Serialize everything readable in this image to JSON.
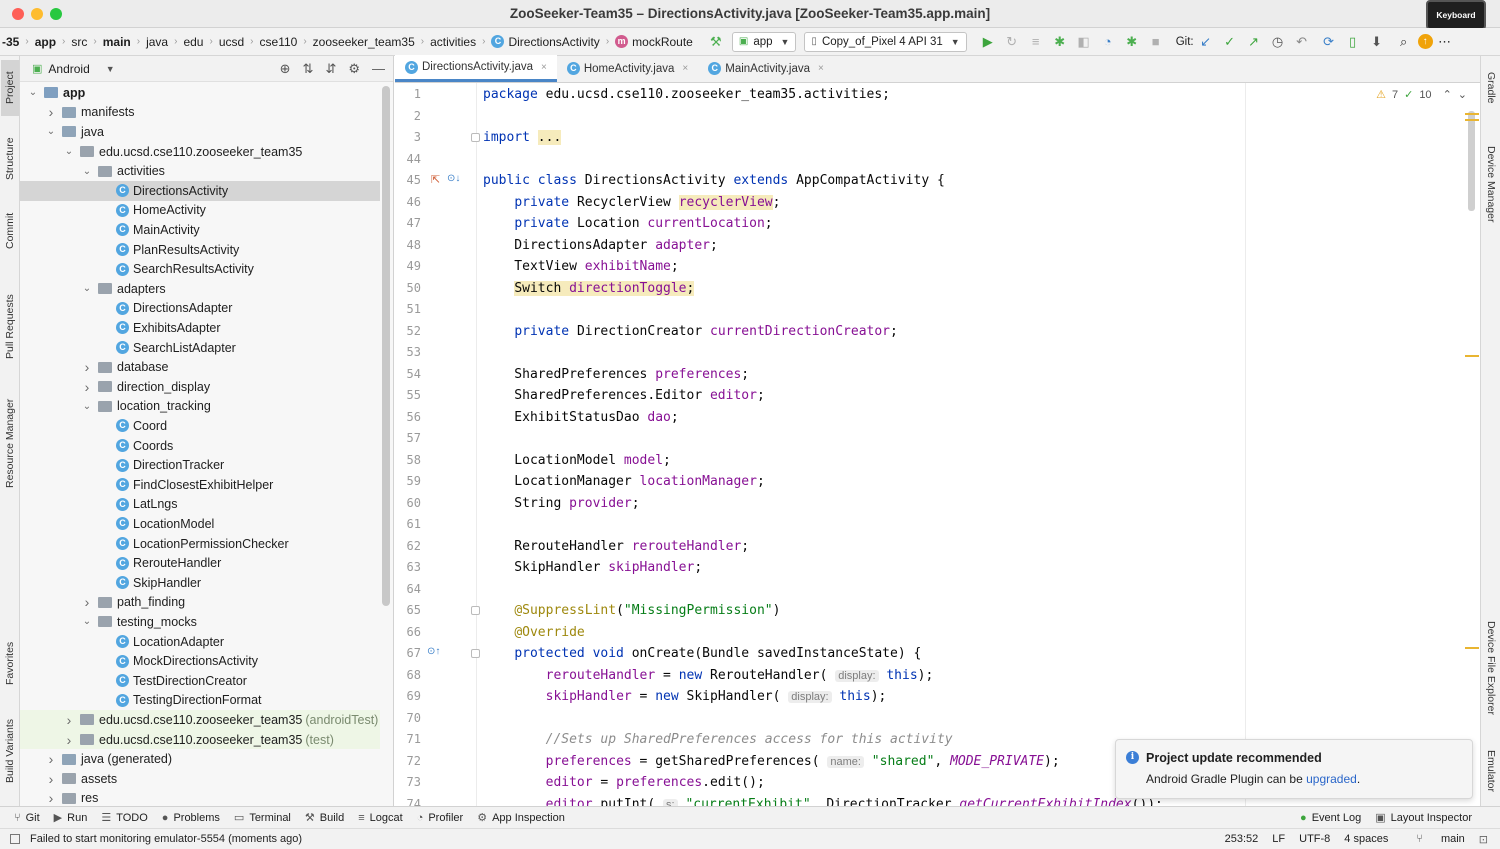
{
  "window": {
    "title": "ZooSeeker-Team35 – DirectionsActivity.java [ZooSeeker-Team35.app.main]",
    "keyboard_badge": "Keyboard"
  },
  "navbar": {
    "breadcrumbs": [
      "-35",
      "app",
      "src",
      "main",
      "java",
      "edu",
      "ucsd",
      "cse110",
      "zooseeker_team35",
      "activities",
      "DirectionsActivity",
      "mockRoute"
    ],
    "run_config": "app",
    "device": "Copy_of_Pixel 4 API 31",
    "git_label": "Git:"
  },
  "left_strip": {
    "tabs": [
      "Project",
      "Structure",
      "Commit",
      "Pull Requests",
      "Resource Manager",
      "Favorites",
      "Build Variants"
    ]
  },
  "right_strip": {
    "tabs": [
      "Gradle",
      "Device Manager",
      "Device File Explorer",
      "Emulator"
    ]
  },
  "project_panel": {
    "view_mode": "Android",
    "tree": [
      {
        "label": "app",
        "level": 0,
        "expanded": true,
        "kind": "module",
        "bold": true
      },
      {
        "label": "manifests",
        "level": 1,
        "expanded": false,
        "kind": "folder"
      },
      {
        "label": "java",
        "level": 1,
        "expanded": true,
        "kind": "folder"
      },
      {
        "label": "edu.ucsd.cse110.zooseeker_team35",
        "level": 2,
        "expanded": true,
        "kind": "package"
      },
      {
        "label": "activities",
        "level": 3,
        "expanded": true,
        "kind": "package"
      },
      {
        "label": "DirectionsActivity",
        "level": 4,
        "kind": "class",
        "selected": true
      },
      {
        "label": "HomeActivity",
        "level": 4,
        "kind": "class"
      },
      {
        "label": "MainActivity",
        "level": 4,
        "kind": "class"
      },
      {
        "label": "PlanResultsActivity",
        "level": 4,
        "kind": "class"
      },
      {
        "label": "SearchResultsActivity",
        "level": 4,
        "kind": "class"
      },
      {
        "label": "adapters",
        "level": 3,
        "expanded": true,
        "kind": "package"
      },
      {
        "label": "DirectionsAdapter",
        "level": 4,
        "kind": "class"
      },
      {
        "label": "ExhibitsAdapter",
        "level": 4,
        "kind": "class"
      },
      {
        "label": "SearchListAdapter",
        "level": 4,
        "kind": "class"
      },
      {
        "label": "database",
        "level": 3,
        "expanded": false,
        "kind": "package"
      },
      {
        "label": "direction_display",
        "level": 3,
        "expanded": false,
        "kind": "package"
      },
      {
        "label": "location_tracking",
        "level": 3,
        "expanded": true,
        "kind": "package"
      },
      {
        "label": "Coord",
        "level": 4,
        "kind": "class"
      },
      {
        "label": "Coords",
        "level": 4,
        "kind": "class"
      },
      {
        "label": "DirectionTracker",
        "level": 4,
        "kind": "class"
      },
      {
        "label": "FindClosestExhibitHelper",
        "level": 4,
        "kind": "class"
      },
      {
        "label": "LatLngs",
        "level": 4,
        "kind": "class"
      },
      {
        "label": "LocationModel",
        "level": 4,
        "kind": "class"
      },
      {
        "label": "LocationPermissionChecker",
        "level": 4,
        "kind": "class"
      },
      {
        "label": "RerouteHandler",
        "level": 4,
        "kind": "class"
      },
      {
        "label": "SkipHandler",
        "level": 4,
        "kind": "class"
      },
      {
        "label": "path_finding",
        "level": 3,
        "expanded": false,
        "kind": "package"
      },
      {
        "label": "testing_mocks",
        "level": 3,
        "expanded": true,
        "kind": "package"
      },
      {
        "label": "LocationAdapter",
        "level": 4,
        "kind": "class"
      },
      {
        "label": "MockDirectionsActivity",
        "level": 4,
        "kind": "class"
      },
      {
        "label": "TestDirectionCreator",
        "level": 4,
        "kind": "class"
      },
      {
        "label": "TestingDirectionFormat",
        "level": 4,
        "kind": "class"
      },
      {
        "label": "edu.ucsd.cse110.zooseeker_team35",
        "suffix": "(androidTest)",
        "level": 2,
        "expanded": false,
        "kind": "package",
        "green": true
      },
      {
        "label": "edu.ucsd.cse110.zooseeker_team35",
        "suffix": "(test)",
        "level": 2,
        "expanded": false,
        "kind": "package",
        "green": true
      },
      {
        "label": "java (generated)",
        "level": 1,
        "expanded": false,
        "kind": "folder"
      },
      {
        "label": "assets",
        "level": 1,
        "expanded": false,
        "kind": "folder-plain"
      },
      {
        "label": "res",
        "level": 1,
        "expanded": false,
        "kind": "folder-plain"
      }
    ]
  },
  "editor_tabs": [
    {
      "label": "DirectionsActivity.java",
      "active": true
    },
    {
      "label": "HomeActivity.java",
      "active": false
    },
    {
      "label": "MainActivity.java",
      "active": false
    }
  ],
  "inspection": {
    "warnings": "7",
    "checks": "10"
  },
  "code": [
    {
      "n": "1",
      "segs": [
        [
          "kw",
          "package "
        ],
        [
          "",
          "edu.ucsd.cse110.zooseeker_team35.activities;"
        ]
      ]
    },
    {
      "n": "2",
      "segs": []
    },
    {
      "n": "3",
      "segs": [
        [
          "kw",
          "import "
        ],
        [
          "hl",
          "..."
        ]
      ],
      "fold": true
    },
    {
      "n": "44",
      "segs": []
    },
    {
      "n": "45",
      "segs": [
        [
          "kw",
          "public class "
        ],
        [
          "",
          "DirectionsActivity "
        ],
        [
          "kw",
          "extends "
        ],
        [
          "",
          "AppCompatActivity {"
        ]
      ],
      "mark": "impl"
    },
    {
      "n": "46",
      "segs": [
        [
          "",
          "    "
        ],
        [
          "kw",
          "private "
        ],
        [
          "",
          "RecyclerView "
        ],
        [
          "fld hl",
          "recyclerView"
        ],
        [
          "",
          ";"
        ]
      ]
    },
    {
      "n": "47",
      "segs": [
        [
          "",
          "    "
        ],
        [
          "kw",
          "private "
        ],
        [
          "",
          "Location "
        ],
        [
          "fld",
          "currentLocation"
        ],
        [
          "",
          ";"
        ]
      ]
    },
    {
      "n": "48",
      "segs": [
        [
          "",
          "    DirectionsAdapter "
        ],
        [
          "fld",
          "adapter"
        ],
        [
          "",
          ";"
        ]
      ]
    },
    {
      "n": "49",
      "segs": [
        [
          "",
          "    TextView "
        ],
        [
          "fld",
          "exhibitName"
        ],
        [
          "",
          ";"
        ]
      ]
    },
    {
      "n": "50",
      "segs": [
        [
          "",
          "    "
        ],
        [
          "hl",
          "Switch "
        ],
        [
          "fld hl",
          "directionToggle"
        ],
        [
          "hl",
          ";"
        ]
      ]
    },
    {
      "n": "51",
      "segs": []
    },
    {
      "n": "52",
      "segs": [
        [
          "",
          "    "
        ],
        [
          "kw",
          "private "
        ],
        [
          "",
          "DirectionCreator "
        ],
        [
          "fld",
          "currentDirectionCreator"
        ],
        [
          "",
          ";"
        ]
      ]
    },
    {
      "n": "53",
      "segs": []
    },
    {
      "n": "54",
      "segs": [
        [
          "",
          "    SharedPreferences "
        ],
        [
          "fld",
          "preferences"
        ],
        [
          "",
          ";"
        ]
      ]
    },
    {
      "n": "55",
      "segs": [
        [
          "",
          "    SharedPreferences.Editor "
        ],
        [
          "fld",
          "editor"
        ],
        [
          "",
          ";"
        ]
      ]
    },
    {
      "n": "56",
      "segs": [
        [
          "",
          "    ExhibitStatusDao "
        ],
        [
          "fld",
          "dao"
        ],
        [
          "",
          ";"
        ]
      ]
    },
    {
      "n": "57",
      "segs": []
    },
    {
      "n": "58",
      "segs": [
        [
          "",
          "    LocationModel "
        ],
        [
          "fld",
          "model"
        ],
        [
          "",
          ";"
        ]
      ]
    },
    {
      "n": "59",
      "segs": [
        [
          "",
          "    LocationManager "
        ],
        [
          "fld",
          "locationManager"
        ],
        [
          "",
          ";"
        ]
      ]
    },
    {
      "n": "60",
      "segs": [
        [
          "",
          "    String "
        ],
        [
          "fld",
          "provider"
        ],
        [
          "",
          ";"
        ]
      ]
    },
    {
      "n": "61",
      "segs": []
    },
    {
      "n": "62",
      "segs": [
        [
          "",
          "    RerouteHandler "
        ],
        [
          "fld",
          "rerouteHandler"
        ],
        [
          "",
          ";"
        ]
      ]
    },
    {
      "n": "63",
      "segs": [
        [
          "",
          "    SkipHandler "
        ],
        [
          "fld",
          "skipHandler"
        ],
        [
          "",
          ";"
        ]
      ]
    },
    {
      "n": "64",
      "segs": []
    },
    {
      "n": "65",
      "segs": [
        [
          "",
          "    "
        ],
        [
          "ann",
          "@SuppressLint"
        ],
        [
          "",
          "("
        ],
        [
          "str",
          "\"MissingPermission\""
        ],
        [
          "",
          ")"
        ]
      ],
      "fold": true
    },
    {
      "n": "66",
      "segs": [
        [
          "",
          "    "
        ],
        [
          "ann",
          "@Override"
        ]
      ]
    },
    {
      "n": "67",
      "segs": [
        [
          "",
          "    "
        ],
        [
          "kw",
          "protected void "
        ],
        [
          "",
          "onCreate(Bundle savedInstanceState) {"
        ]
      ],
      "mark": "override",
      "fold": true
    },
    {
      "n": "68",
      "segs": [
        [
          "",
          "        "
        ],
        [
          "fld",
          "rerouteHandler"
        ],
        [
          "",
          " = "
        ],
        [
          "kw",
          "new "
        ],
        [
          "",
          "RerouteHandler( "
        ],
        [
          "hint",
          "display:"
        ],
        [
          "",
          " "
        ],
        [
          "kw",
          "this"
        ],
        [
          "",
          ");"
        ]
      ]
    },
    {
      "n": "69",
      "segs": [
        [
          "",
          "        "
        ],
        [
          "fld",
          "skipHandler"
        ],
        [
          "",
          " = "
        ],
        [
          "kw",
          "new "
        ],
        [
          "",
          "SkipHandler( "
        ],
        [
          "hint",
          "display:"
        ],
        [
          "",
          " "
        ],
        [
          "kw",
          "this"
        ],
        [
          "",
          ");"
        ]
      ]
    },
    {
      "n": "70",
      "segs": []
    },
    {
      "n": "71",
      "segs": [
        [
          "",
          "        "
        ],
        [
          "cmt",
          "//Sets up SharedPreferences access for this activity"
        ]
      ]
    },
    {
      "n": "72",
      "segs": [
        [
          "",
          "        "
        ],
        [
          "fld",
          "preferences"
        ],
        [
          "",
          " = getSharedPreferences( "
        ],
        [
          "hint",
          "name:"
        ],
        [
          "",
          " "
        ],
        [
          "str",
          "\"shared\""
        ],
        [
          "",
          ", "
        ],
        [
          "itc",
          "MODE_PRIVATE"
        ],
        [
          "",
          ");"
        ]
      ]
    },
    {
      "n": "73",
      "segs": [
        [
          "",
          "        "
        ],
        [
          "fld",
          "editor"
        ],
        [
          "",
          " = "
        ],
        [
          "fld",
          "preferences"
        ],
        [
          "",
          ".edit();"
        ]
      ]
    },
    {
      "n": "74",
      "segs": [
        [
          "",
          "        "
        ],
        [
          "fld",
          "editor"
        ],
        [
          "",
          ".putInt( "
        ],
        [
          "hint",
          "s:"
        ],
        [
          "",
          " "
        ],
        [
          "str",
          "\"currentExhibit\""
        ],
        [
          "",
          ", DirectionTracker."
        ],
        [
          "itc",
          "getCurrentExhibitIndex"
        ],
        [
          "",
          "());"
        ]
      ]
    }
  ],
  "notification": {
    "title": "Project update recommended",
    "body": "Android Gradle Plugin can be ",
    "link": "upgraded",
    "end": "."
  },
  "bottom_tools": [
    "Git",
    "Run",
    "TODO",
    "Problems",
    "Terminal",
    "Build",
    "Logcat",
    "Profiler",
    "App Inspection"
  ],
  "bottom_tools_right": [
    "Event Log",
    "Layout Inspector"
  ],
  "status": {
    "message": "Failed to start monitoring emulator-5554 (moments ago)",
    "position": "253:52",
    "line_sep": "LF",
    "encoding": "UTF-8",
    "indent": "4 spaces",
    "branch": "main"
  }
}
